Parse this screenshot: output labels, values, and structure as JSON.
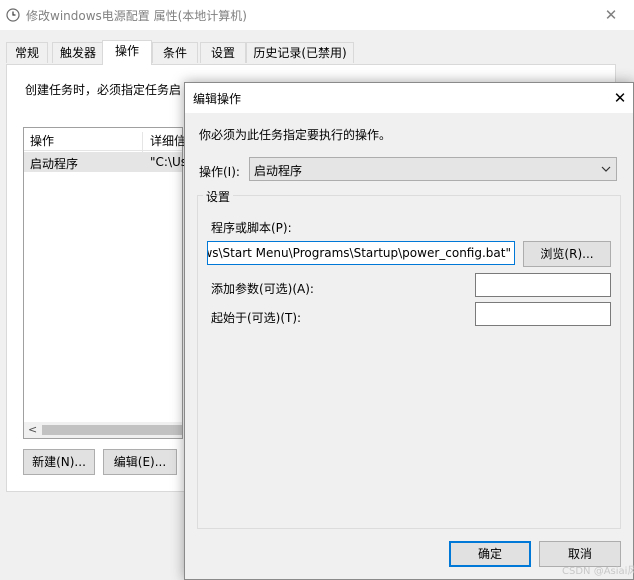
{
  "parent_window": {
    "title": "修改windows电源配置 属性(本地计算机)",
    "close_glyph": "✕",
    "tabs": [
      "常规",
      "触发器",
      "操作",
      "条件",
      "设置",
      "历史记录(已禁用)"
    ],
    "active_tab": "操作",
    "intro_text": "创建任务时，必须指定任务启",
    "list": {
      "columns": [
        "操作",
        "详细信"
      ],
      "rows": [
        {
          "action": "启动程序",
          "details": "\"C:\\Us"
        }
      ]
    },
    "buttons": {
      "new": "新建(N)...",
      "edit": "编辑(E)..."
    }
  },
  "dialog": {
    "title": "编辑操作",
    "close_glyph": "✕",
    "prompt": "你必须为此任务指定要执行的操作。",
    "action_label": "操作(I):",
    "action_value": "启动程序",
    "settings_legend": "设置",
    "program_label": "程序或脚本(P):",
    "program_value": "ws\\Start Menu\\Programs\\Startup\\power_config.bat\"",
    "browse_label": "浏览(R)...",
    "args_label": "添加参数(可选)(A):",
    "args_value": "",
    "start_in_label": "起始于(可选)(T):",
    "start_in_value": "",
    "ok_label": "确定",
    "cancel_label": "取消"
  },
  "watermark": "CSDN @Asiai风",
  "colors": {
    "focus_blue": "#0078d7",
    "selection_gray": "#e5e5e5",
    "button_face": "#e1e1e1"
  },
  "icons": {
    "window_icon": "clock-icon",
    "dropdown": "chevron-down-icon"
  }
}
